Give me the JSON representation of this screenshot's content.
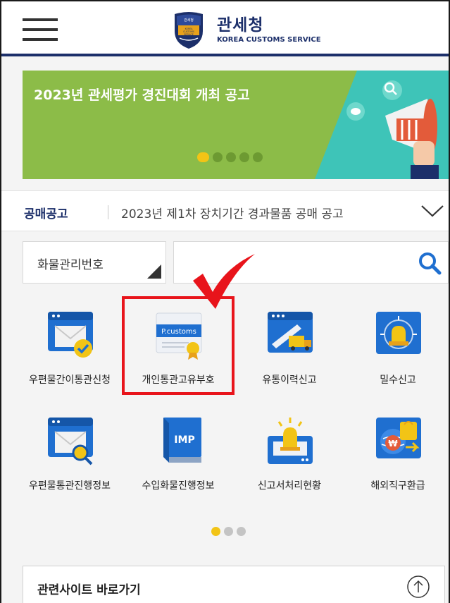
{
  "header": {
    "title": "관세청",
    "subtitle": "KOREA CUSTOMS SERVICE",
    "emblem_text_top": "관세청",
    "emblem_text_bottom": "KOREA CUSTOMS SERVICE"
  },
  "banner": {
    "title": "2023년 관세평가 경진대회 개최 공고",
    "slide_count": 5,
    "active_slide": 1
  },
  "notice": {
    "label": "공매공고",
    "text": "2023년 제1차 장치기간 경과물품 공매 공고"
  },
  "search": {
    "select_value": "화물관리번호",
    "placeholder": ""
  },
  "menu": [
    {
      "label": "우편물간이통관신청",
      "icon": "mail-check-icon"
    },
    {
      "label": "개인통관고유부호",
      "icon": "p-customs-certificate-icon",
      "icon_text": "P.customs"
    },
    {
      "label": "유통이력신고",
      "icon": "truck-report-icon"
    },
    {
      "label": "밀수신고",
      "icon": "alarm-siren-icon"
    },
    {
      "label": "우편물통관진행정보",
      "icon": "mail-search-icon"
    },
    {
      "label": "수입화물진행정보",
      "icon": "imp-book-icon",
      "icon_text": "IMP"
    },
    {
      "label": "신고서처리현황",
      "icon": "siren-status-icon"
    },
    {
      "label": "해외직구환급",
      "icon": "overseas-refund-icon"
    }
  ],
  "pager": {
    "page_count": 3,
    "active_page": 1
  },
  "related": {
    "label": "관련사이트 바로가기"
  },
  "colors": {
    "navy": "#1c2f6a",
    "banner_green": "#8cbc48",
    "highlight_red": "#e8141b",
    "active_dot": "#f2c416",
    "icon_blue": "#1f6fd0"
  }
}
